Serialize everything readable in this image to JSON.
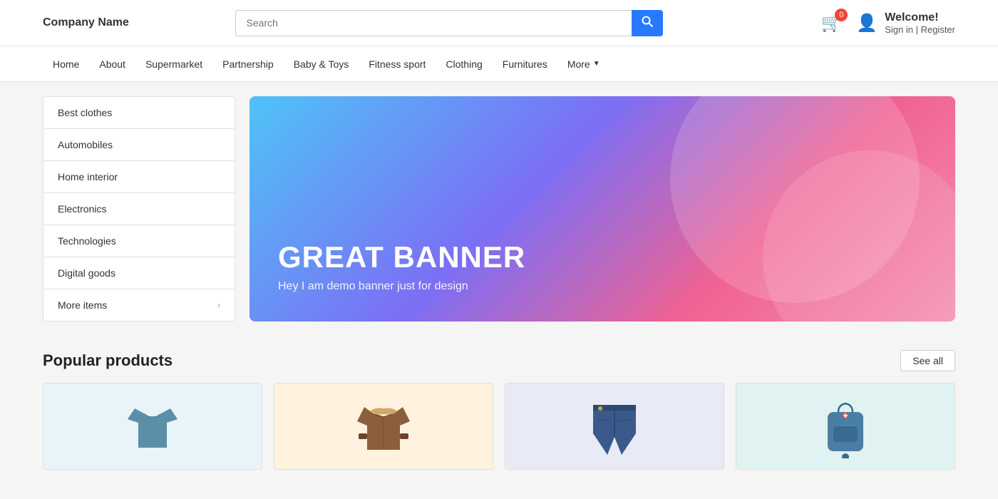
{
  "header": {
    "logo": "Company Name",
    "search": {
      "placeholder": "Search",
      "value": ""
    },
    "cart": {
      "badge": "0"
    },
    "user": {
      "welcome": "Welcome!",
      "sign_links": "Sign in | Register"
    }
  },
  "nav": {
    "items": [
      {
        "label": "Home",
        "id": "home"
      },
      {
        "label": "About",
        "id": "about"
      },
      {
        "label": "Supermarket",
        "id": "supermarket"
      },
      {
        "label": "Partnership",
        "id": "partnership"
      },
      {
        "label": "Baby &amp; Toys",
        "id": "baby-toys"
      },
      {
        "label": "Fitness sport",
        "id": "fitness-sport"
      },
      {
        "label": "Clothing",
        "id": "clothing"
      },
      {
        "label": "Furnitures",
        "id": "furnitures"
      }
    ],
    "more": "More"
  },
  "sidebar": {
    "items": [
      {
        "label": "Best clothes",
        "has_chevron": false
      },
      {
        "label": "Automobiles",
        "has_chevron": false
      },
      {
        "label": "Home interior",
        "has_chevron": false
      },
      {
        "label": "Electronics",
        "has_chevron": false
      },
      {
        "label": "Technologies",
        "has_chevron": false
      },
      {
        "label": "Digital goods",
        "has_chevron": false
      },
      {
        "label": "More items",
        "has_chevron": true
      }
    ]
  },
  "banner": {
    "title": "GREAT BANNER",
    "subtitle": "Hey I am demo banner just for design"
  },
  "popular": {
    "title": "Popular products",
    "see_all": "See all",
    "products": [
      {
        "id": "shirt",
        "type": "shirt"
      },
      {
        "id": "jacket",
        "type": "jacket"
      },
      {
        "id": "jeans",
        "type": "jeans"
      },
      {
        "id": "bag",
        "type": "bag"
      }
    ]
  }
}
